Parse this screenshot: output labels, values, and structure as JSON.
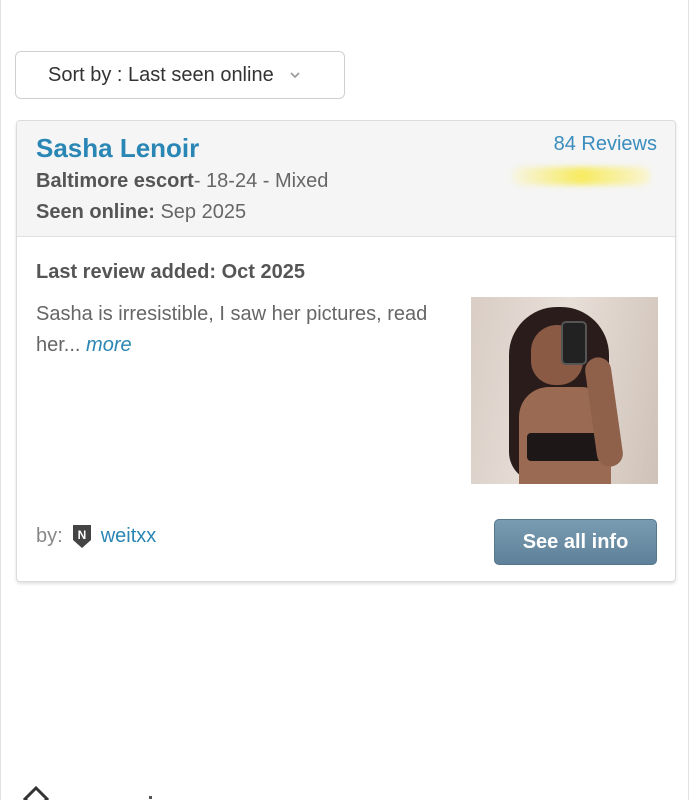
{
  "sort": {
    "label": "Sort by : Last seen online"
  },
  "listing": {
    "name": "Sasha Lenoir",
    "reviews_count_label": "84 Reviews",
    "location_prefix": "Baltimore escort",
    "details_suffix": "- 18-24 - Mixed",
    "seen_label": "Seen online:",
    "seen_value": "Sep 2025",
    "last_review_label": "Last review added: Oct 2025",
    "excerpt": "Sasha is irresistible, I saw her pictures, read her...",
    "more_label": "more",
    "by_label": "by:",
    "reviewer": "weitxx",
    "see_all_label": "See all info"
  },
  "colors": {
    "accent": "#2a86b4",
    "button": "#6a8ea6",
    "rating_highlight": "#f7e950"
  },
  "icons": {
    "sort_chevron": "chevron-down-icon",
    "reviewer_badge": "n-shield-icon"
  }
}
